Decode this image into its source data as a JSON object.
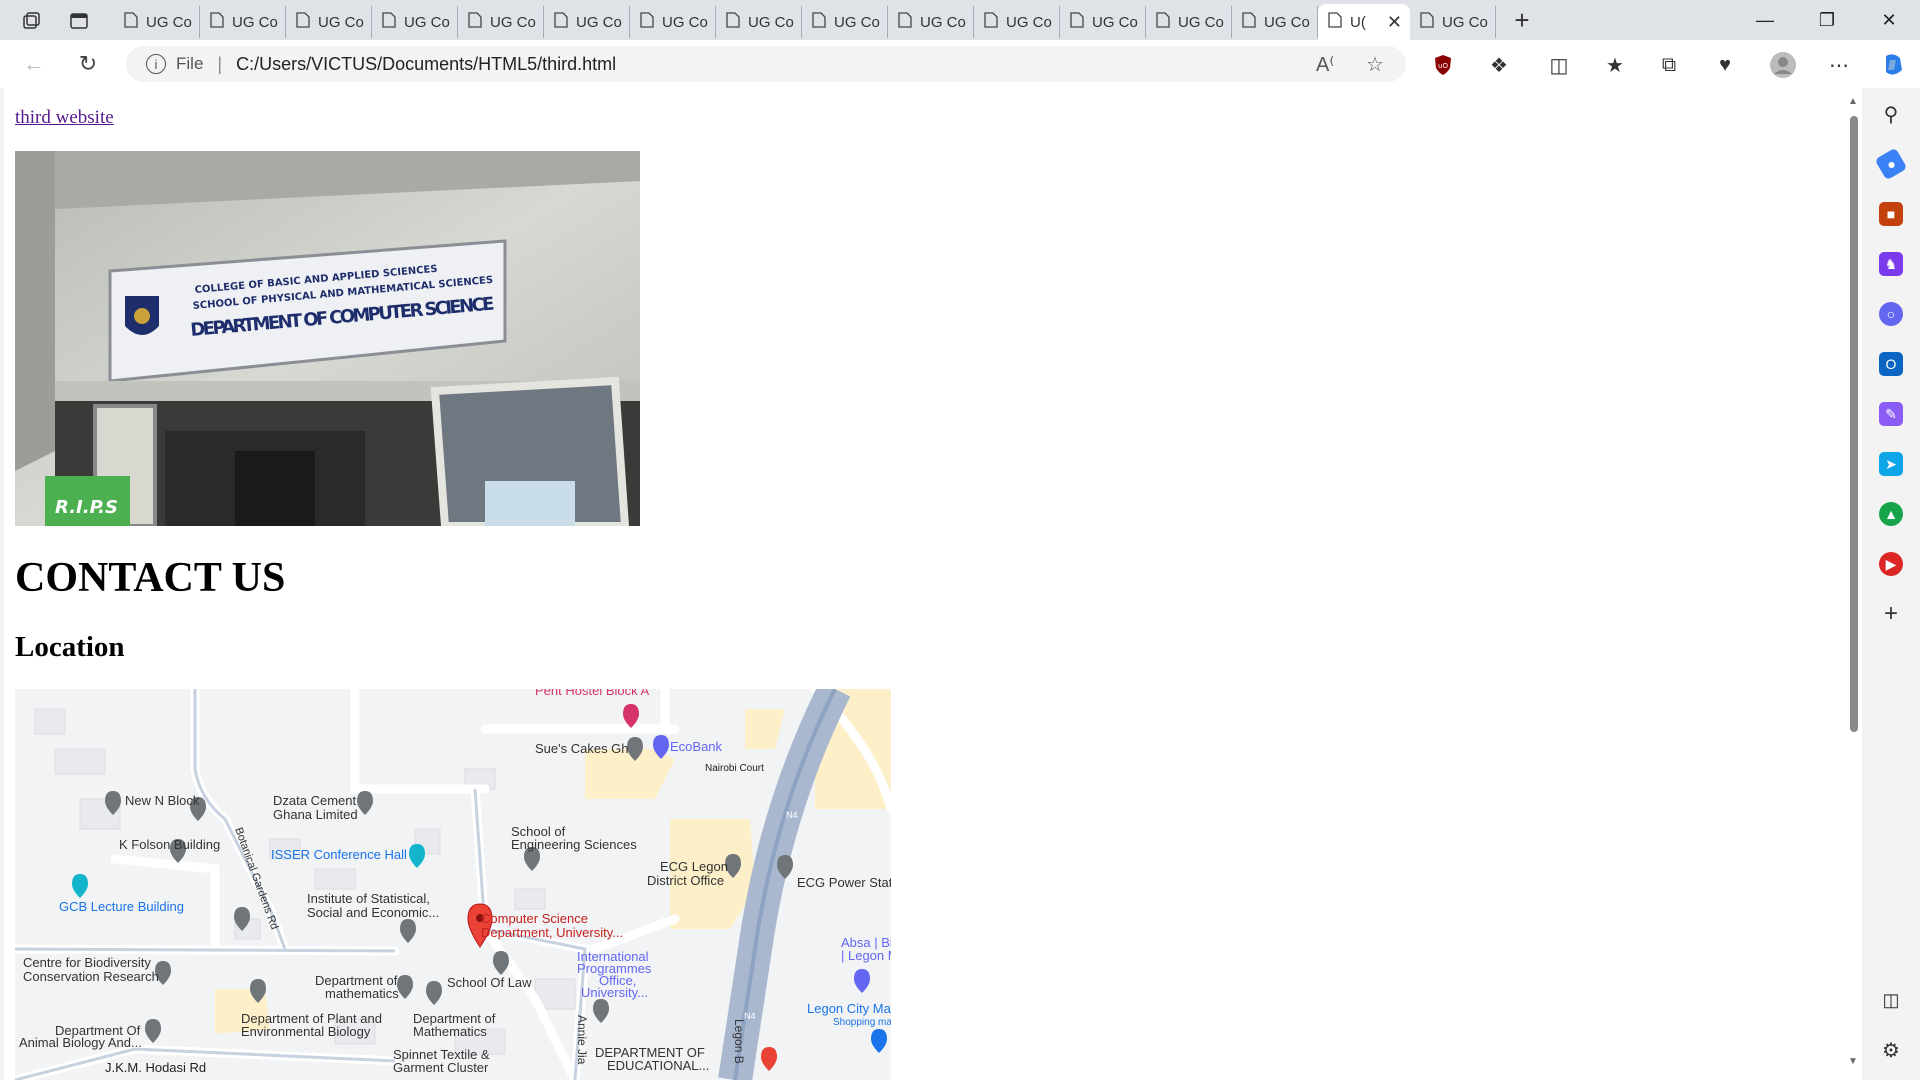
{
  "browser": {
    "tabs": [
      {
        "label": "UG Co"
      },
      {
        "label": "UG Co"
      },
      {
        "label": "UG Co"
      },
      {
        "label": "UG Co"
      },
      {
        "label": "UG Co"
      },
      {
        "label": "UG Co"
      },
      {
        "label": "UG Co"
      },
      {
        "label": "UG Co"
      },
      {
        "label": "UG Co"
      },
      {
        "label": "UG Co"
      },
      {
        "label": "UG Co"
      },
      {
        "label": "UG Co"
      },
      {
        "label": "UG Co"
      },
      {
        "label": "UG Co"
      },
      {
        "label": "U(",
        "active": true
      },
      {
        "label": "UG Co"
      }
    ],
    "address": {
      "scheme_label": "File",
      "url": "C:/Users/VICTUS/Documents/HTML5/third.html"
    }
  },
  "page": {
    "link_text": "third website",
    "heading": "CONTACT US",
    "subheading": "Location",
    "photo": {
      "sign_line1": "COLLEGE OF BASIC AND APPLIED SCIENCES",
      "sign_line2": "SCHOOL OF PHYSICAL AND MATHEMATICAL SCIENCES",
      "sign_line3": "DEPARTMENT OF COMPUTER SCIENCE",
      "door_sign": "R.I.P.S"
    },
    "map": {
      "labels": [
        {
          "text": "Pent Hostel Block A"
        },
        {
          "text": "Sue's Cakes Gh"
        },
        {
          "text": "EcoBank"
        },
        {
          "text": "Nairobi Court"
        },
        {
          "text": "New N Block"
        },
        {
          "text": "Dzata Cement"
        },
        {
          "text": "Ghana Limited"
        },
        {
          "text": "K Folson Building"
        },
        {
          "text": "Botanical Gardens Rd"
        },
        {
          "text": "ISSER Conference Hall"
        },
        {
          "text": "School of"
        },
        {
          "text": "Engineering Sciences"
        },
        {
          "text": "ECG Legon"
        },
        {
          "text": "District Office"
        },
        {
          "text": "ECG Power Stati"
        },
        {
          "text": "GCB Lecture Building"
        },
        {
          "text": "Institute of Statistical,"
        },
        {
          "text": "Social and Economic..."
        },
        {
          "text": "Computer Science"
        },
        {
          "text": "Department, University..."
        },
        {
          "text": "International"
        },
        {
          "text": "Programmes"
        },
        {
          "text": "Office,"
        },
        {
          "text": "University..."
        },
        {
          "text": "Absa | Br"
        },
        {
          "text": "| Legon M"
        },
        {
          "text": "Centre for Biodiversity"
        },
        {
          "text": "Conservation Research"
        },
        {
          "text": "Department of"
        },
        {
          "text": "mathematics"
        },
        {
          "text": "School Of Law"
        },
        {
          "text": "Legon City Mal"
        },
        {
          "text": "Shopping ma"
        },
        {
          "text": "Department Of"
        },
        {
          "text": "Animal Biology And..."
        },
        {
          "text": "Department of Plant and"
        },
        {
          "text": "Environmental Biology"
        },
        {
          "text": "Department of"
        },
        {
          "text": "Mathematics"
        },
        {
          "text": "Annie Jia"
        },
        {
          "text": "Legon B"
        },
        {
          "text": "J.K.M. Hodasi Rd"
        },
        {
          "text": "Spinnet Textile &"
        },
        {
          "text": "Garment Cluster"
        },
        {
          "text": "DEPARTMENT OF"
        },
        {
          "text": "EDUCATIONAL..."
        },
        {
          "text": "N4"
        },
        {
          "text": "N4"
        }
      ]
    }
  }
}
